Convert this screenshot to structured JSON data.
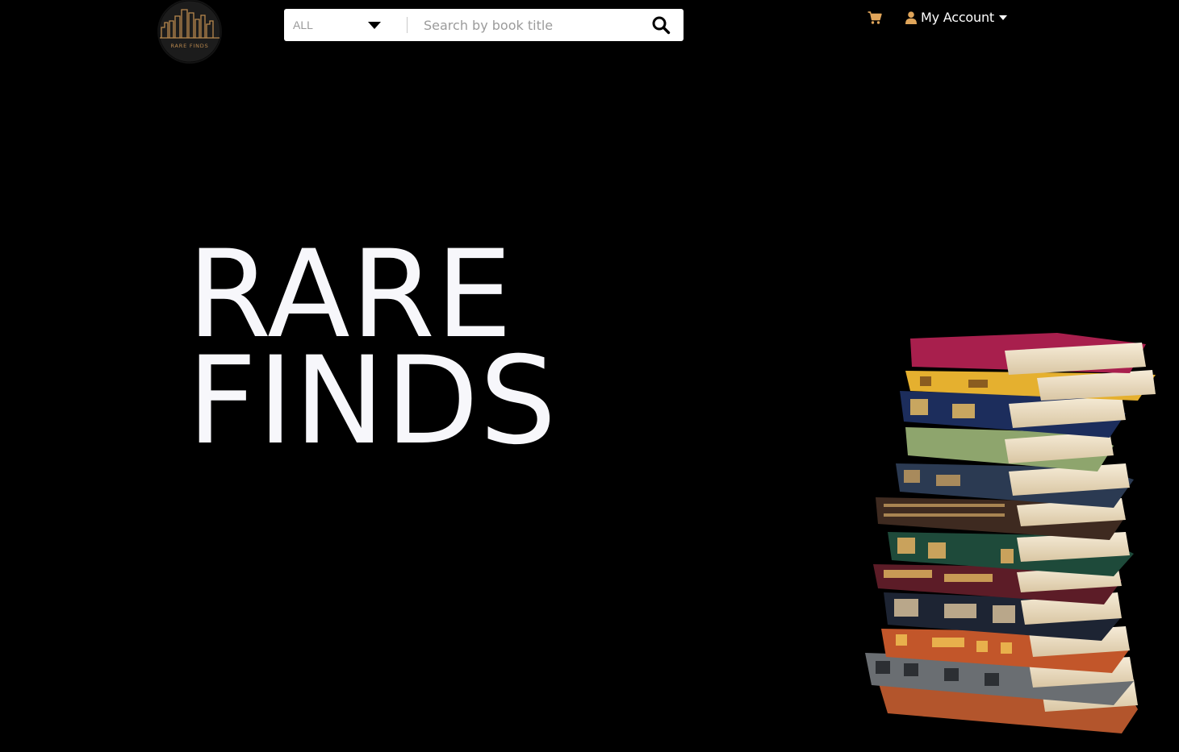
{
  "brand": {
    "logo_text": "RARE FINDS",
    "logo_color": "#b8884e"
  },
  "search": {
    "category": "ALL",
    "placeholder": "Search by book title",
    "value": ""
  },
  "nav": {
    "account_label": "My Account",
    "accent_color": "#e0a55a"
  },
  "hero": {
    "line1": "RARE",
    "line2": "FINDS"
  },
  "icons": {
    "search": "search-icon",
    "cart": "cart-icon",
    "user": "user-icon",
    "dropdown": "caret-down-icon"
  }
}
